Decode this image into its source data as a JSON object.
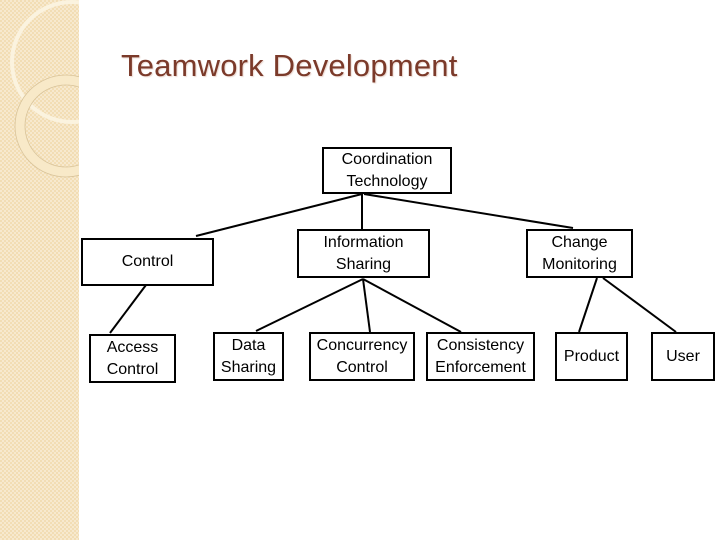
{
  "slide": {
    "title": "Teamwork Development",
    "title_color": "#7b3a2a",
    "side_strip_color": "#f2ddb4"
  },
  "diagram": {
    "type": "hierarchy",
    "root": {
      "id": "coordination-technology",
      "label": "Coordination\nTechnology"
    },
    "level1": [
      {
        "id": "control",
        "label": "Control",
        "parent": "coordination-technology"
      },
      {
        "id": "information-sharing",
        "label": "Information\nSharing",
        "parent": "coordination-technology"
      },
      {
        "id": "change-monitoring",
        "label": "Change\nMonitoring",
        "parent": "coordination-technology"
      }
    ],
    "level2": [
      {
        "id": "access-control",
        "label": "Access\nControl",
        "parent": "control"
      },
      {
        "id": "data-sharing",
        "label": "Data\nSharing",
        "parent": "information-sharing"
      },
      {
        "id": "concurrency-control",
        "label": "Concurrency\nControl",
        "parent": "information-sharing"
      },
      {
        "id": "consistency-enforcement",
        "label": "Consistency\nEnforcement",
        "parent": "information-sharing"
      },
      {
        "id": "product",
        "label": "Product",
        "parent": "change-monitoring"
      },
      {
        "id": "user",
        "label": "User",
        "parent": "change-monitoring"
      }
    ]
  }
}
